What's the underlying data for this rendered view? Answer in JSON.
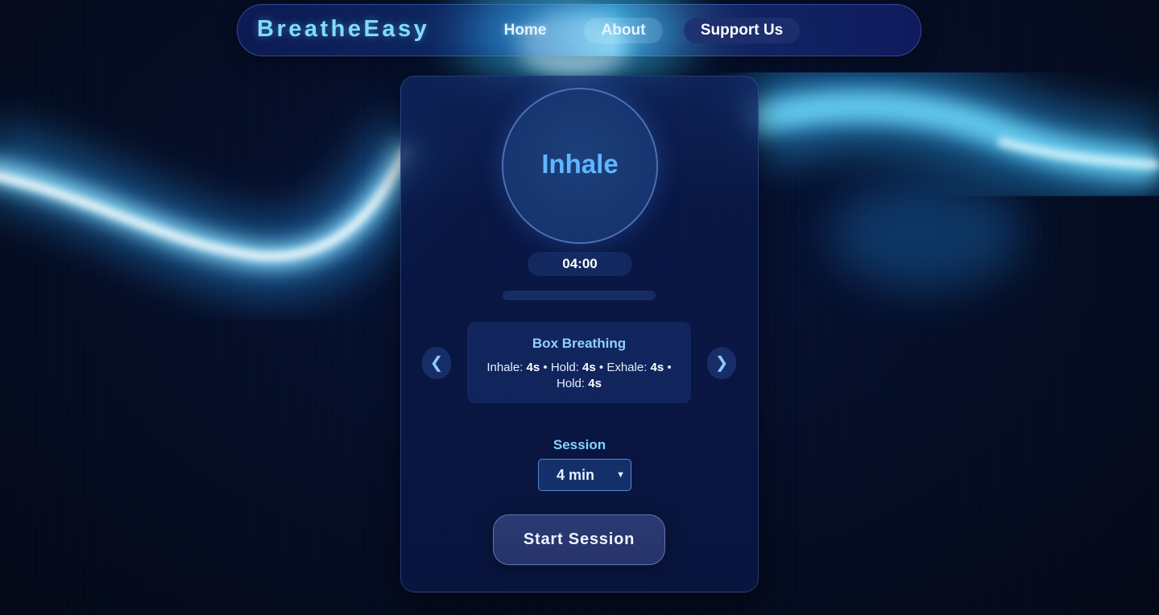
{
  "header": {
    "brand": "BreatheEasy",
    "nav": {
      "home": "Home",
      "about": "About",
      "support": "Support Us"
    }
  },
  "breath": {
    "phase": "Inhale",
    "timer": "04:00",
    "progress_percent": 0
  },
  "pattern": {
    "prev_icon": "❮",
    "next_icon": "❯",
    "name": "Box Breathing",
    "steps": [
      {
        "label": "Inhale:",
        "value": "4s"
      },
      {
        "label": "Hold:",
        "value": "4s"
      },
      {
        "label": "Exhale:",
        "value": "4s"
      },
      {
        "label": "Hold:",
        "value": "4s"
      }
    ],
    "separator": "•"
  },
  "session": {
    "label": "Session",
    "selected": "4 min"
  },
  "start_button": "Start Session",
  "colors": {
    "accent": "#7fdcff",
    "phase_text": "#5fb6ff",
    "background": "#030a1c"
  }
}
